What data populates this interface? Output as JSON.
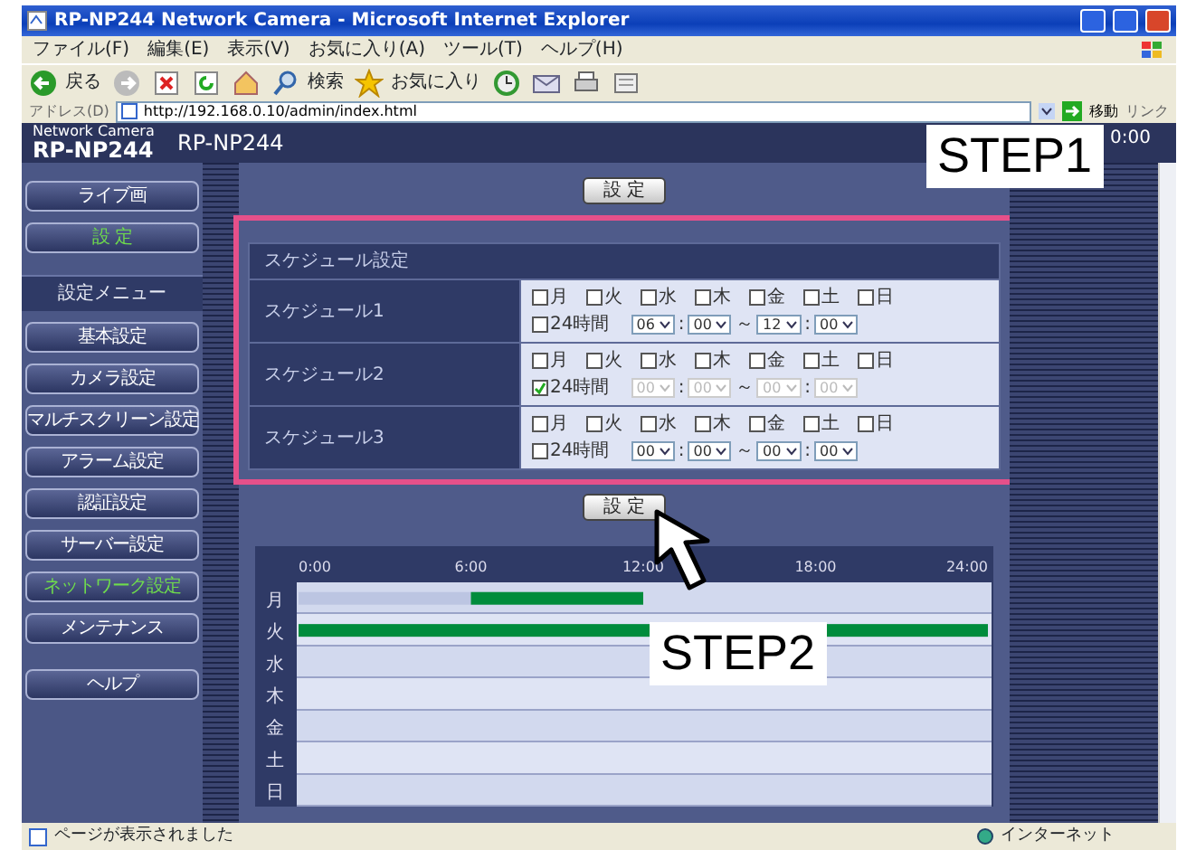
{
  "window": {
    "title": "RP-NP244 Network Camera - Microsoft Internet Explorer"
  },
  "menu": [
    "ファイル(F)",
    "編集(E)",
    "表示(V)",
    "お気に入り(A)",
    "ツール(T)",
    "ヘルプ(H)"
  ],
  "toolbar": [
    {
      "kind": "back",
      "label": "戻る"
    },
    {
      "kind": "forward"
    },
    {
      "kind": "stop"
    },
    {
      "kind": "refresh"
    },
    {
      "kind": "home"
    },
    {
      "kind": "search",
      "label": "検索"
    },
    {
      "kind": "favorites",
      "label": "お気に入り"
    },
    {
      "kind": "history"
    },
    {
      "kind": "mail"
    },
    {
      "kind": "print"
    },
    {
      "kind": "edit"
    }
  ],
  "address": {
    "label": "アドレス(D)",
    "url": "http://192.168.0.10/admin/index.html",
    "go": "移動",
    "links": "リンク"
  },
  "header": {
    "brand_small": "Network Camera",
    "brand": "RP-NP244",
    "title": "RP-NP244",
    "time": "0:00"
  },
  "sidebar": [
    {
      "kind": "button",
      "label": "ライブ画",
      "selected": false
    },
    {
      "kind": "button",
      "label": "設 定",
      "selected": true
    },
    {
      "kind": "heading",
      "label": "設定メニュー"
    },
    {
      "kind": "button",
      "label": "基本設定",
      "selected": false
    },
    {
      "kind": "button",
      "label": "カメラ設定",
      "selected": false
    },
    {
      "kind": "button",
      "label": "マルチスクリーン設定",
      "selected": false
    },
    {
      "kind": "button",
      "label": "アラーム設定",
      "selected": false
    },
    {
      "kind": "button",
      "label": "認証設定",
      "selected": false
    },
    {
      "kind": "button",
      "label": "サーバー設定",
      "selected": false
    },
    {
      "kind": "button",
      "label": "ネットワーク設定",
      "selected": true
    },
    {
      "kind": "button",
      "label": "メンテナンス",
      "selected": false
    },
    {
      "kind": "button",
      "label": "ヘルプ",
      "selected": false
    }
  ],
  "top_button": "設 定",
  "schedule": {
    "title": "スケジュール設定",
    "rows": [
      {
        "label": "スケジュール1",
        "days": [
          {
            "label": "月",
            "checked": false
          },
          {
            "label": "火",
            "checked": false
          },
          {
            "label": "水",
            "checked": false
          },
          {
            "label": "木",
            "checked": false
          },
          {
            "label": "金",
            "checked": false
          },
          {
            "label": "土",
            "checked": false
          },
          {
            "label": "日",
            "checked": false
          }
        ],
        "all_day": {
          "label": "24時間",
          "checked": false
        },
        "disabled": false,
        "from_hour": "06",
        "from_minute": "00",
        "to_hour": "12",
        "to_minute": "00",
        "time_separator": ":",
        "range_separator": "～"
      },
      {
        "label": "スケジュール2",
        "days": [
          {
            "label": "月",
            "checked": false
          },
          {
            "label": "火",
            "checked": false
          },
          {
            "label": "水",
            "checked": false
          },
          {
            "label": "木",
            "checked": false
          },
          {
            "label": "金",
            "checked": false
          },
          {
            "label": "土",
            "checked": false
          },
          {
            "label": "日",
            "checked": false
          }
        ],
        "all_day": {
          "label": "24時間",
          "checked": true
        },
        "disabled": true,
        "from_hour": "00",
        "from_minute": "00",
        "to_hour": "00",
        "to_minute": "00",
        "time_separator": ":",
        "range_separator": "～"
      },
      {
        "label": "スケジュール3",
        "days": [
          {
            "label": "月",
            "checked": false
          },
          {
            "label": "火",
            "checked": false
          },
          {
            "label": "水",
            "checked": false
          },
          {
            "label": "木",
            "checked": false
          },
          {
            "label": "金",
            "checked": false
          },
          {
            "label": "土",
            "checked": false
          },
          {
            "label": "日",
            "checked": false
          }
        ],
        "all_day": {
          "label": "24時間",
          "checked": false
        },
        "disabled": false,
        "from_hour": "00",
        "from_minute": "00",
        "to_hour": "00",
        "to_minute": "00",
        "time_separator": ":",
        "range_separator": "～"
      }
    ]
  },
  "bottom_button": "設 定",
  "timeline": {
    "chart_data": {
      "type": "bar",
      "orientation": "horizontal",
      "stacked": true,
      "categories": [
        "月",
        "火",
        "水",
        "木",
        "金",
        "土",
        "日"
      ],
      "series": [
        {
          "color": "#bcc5e2",
          "values": [
            6,
            0,
            0,
            0,
            0,
            0,
            0
          ]
        },
        {
          "color": "#008c3c",
          "values": [
            6,
            24,
            0,
            0,
            0,
            0,
            0
          ]
        }
      ],
      "xlim": [
        0,
        24
      ],
      "xticks": [
        {
          "value": 0,
          "label": "0:00"
        },
        {
          "value": 6,
          "label": "6:00"
        },
        {
          "value": 12,
          "label": "12:00"
        },
        {
          "value": 18,
          "label": "18:00"
        },
        {
          "value": 24,
          "label": "24:00"
        }
      ]
    }
  },
  "annotations": [
    {
      "text": "STEP1"
    },
    {
      "text": "STEP2"
    }
  ],
  "status_bar": {
    "text": "ページが表示されました",
    "zone": "インターネット"
  }
}
